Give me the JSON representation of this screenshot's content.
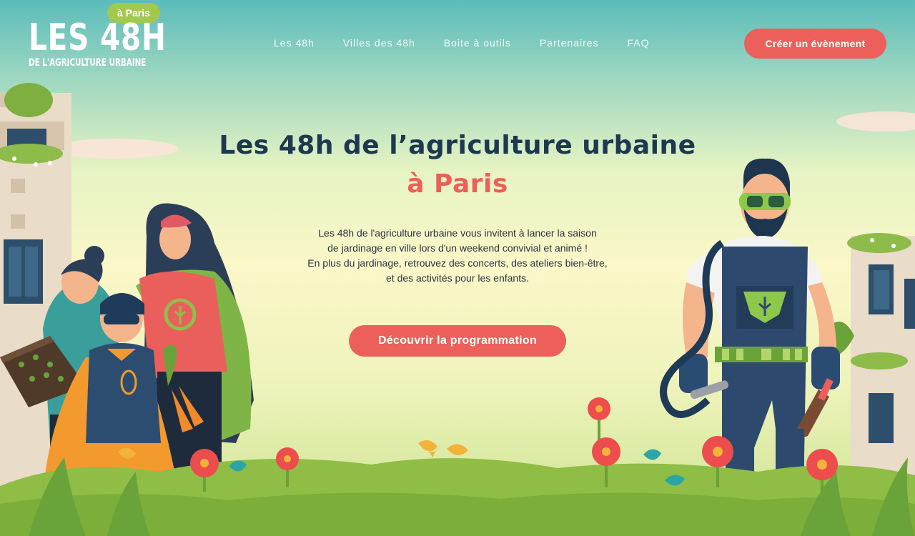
{
  "logo": {
    "line1": "LES 48H",
    "line2": "DE L'AGRICULTURE URBAINE",
    "badge": "à Paris"
  },
  "nav": {
    "items": [
      {
        "label": "Les 48h"
      },
      {
        "label": "Villes des 48h"
      },
      {
        "label": "Boite à outils"
      },
      {
        "label": "Partenaires"
      },
      {
        "label": "FAQ"
      }
    ],
    "cta_label": "Créer un évènement"
  },
  "hero": {
    "title": "Les 48h de l’agriculture urbaine",
    "subtitle": "à Paris",
    "description": [
      "Les 48h de l'agriculture urbaine vous invitent à lancer la saison",
      "de jardinage en ville lors d'un weekend convivial et animé !",
      "En plus du jardinage, retrouvez des concerts, des ateliers bien-être,",
      "et des activités pour les enfants."
    ],
    "button_label": "Découvrir la programmation"
  },
  "colors": {
    "accent": "#ed5f5a",
    "title": "#1d3850",
    "badge": "#a2c94d",
    "grass": "#8fbd45"
  },
  "illustration": {
    "icons": [
      "building-left",
      "building-right",
      "family-group",
      "gardener-hero",
      "flowers",
      "grass",
      "clouds"
    ]
  }
}
